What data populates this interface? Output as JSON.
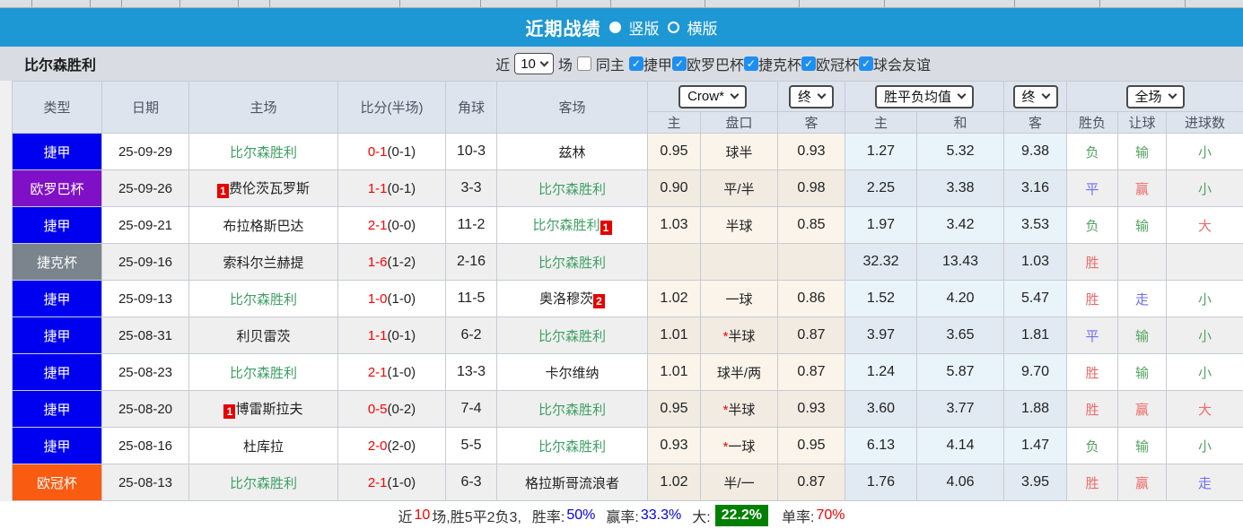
{
  "title_bar": {
    "title": "近期战绩",
    "radio_vertical": "竖版",
    "radio_horizontal": "横版"
  },
  "filter_bar": {
    "team": "比尔森胜利",
    "near_label": "近",
    "count_value": "10",
    "games_label": "场",
    "same_home_label": "同主",
    "league_filters": [
      "捷甲",
      "欧罗巴杯",
      "捷克杯",
      "欧冠杯",
      "球会友谊"
    ]
  },
  "table": {
    "columns": [
      "类型",
      "日期",
      "主场",
      "比分(半场)",
      "角球",
      "客场"
    ],
    "subcols": [
      "主",
      "盘口",
      "客",
      "主",
      "和",
      "客",
      "胜负",
      "让球",
      "进球数"
    ],
    "selects": {
      "bookmaker": "Crow*",
      "bookmaker_time": "终",
      "mean": "胜平负均值",
      "mean_time": "终",
      "scope": "全场"
    },
    "rows": [
      {
        "type": "捷甲",
        "typeColor": "#0000f0",
        "date": "25-09-29",
        "home": {
          "name": "比尔森胜利",
          "green": true
        },
        "score": "0-1",
        "half": "(0-1)",
        "corner": "10-3",
        "away": {
          "name": "兹林"
        },
        "crowHome": "0.95",
        "handicap": "球半",
        "star": false,
        "crowAway": "0.93",
        "mean": [
          "1.27",
          "5.32",
          "9.38"
        ],
        "res": [
          [
            "负",
            "green"
          ],
          [
            "输",
            "green"
          ],
          [
            "小",
            "green"
          ]
        ]
      },
      {
        "type": "欧罗巴杯",
        "typeColor": "#8010c8",
        "date": "25-09-26",
        "home": {
          "name": "费伦茨瓦罗斯",
          "redcard": "1",
          "redpos": "before"
        },
        "score": "1-1",
        "half": "(0-1)",
        "corner": "3-3",
        "away": {
          "name": "比尔森胜利",
          "green": true
        },
        "crowHome": "0.90",
        "handicap": "平/半",
        "star": false,
        "crowAway": "0.98",
        "mean": [
          "2.25",
          "3.38",
          "3.16"
        ],
        "res": [
          [
            "平",
            "blue"
          ],
          [
            "赢",
            "red"
          ],
          [
            "小",
            "green"
          ]
        ]
      },
      {
        "type": "捷甲",
        "typeColor": "#0000f0",
        "date": "25-09-21",
        "home": {
          "name": "布拉格斯巴达"
        },
        "score": "2-1",
        "half": "(0-0)",
        "corner": "11-2",
        "away": {
          "name": "比尔森胜利",
          "green": true,
          "redcard": "1",
          "redpos": "after"
        },
        "crowHome": "1.03",
        "handicap": "半球",
        "star": false,
        "crowAway": "0.85",
        "mean": [
          "1.97",
          "3.42",
          "3.53"
        ],
        "res": [
          [
            "负",
            "green"
          ],
          [
            "输",
            "green"
          ],
          [
            "大",
            "red"
          ]
        ]
      },
      {
        "type": "捷克杯",
        "typeColor": "#7b848c",
        "date": "25-09-16",
        "home": {
          "name": "索科尔兰赫提"
        },
        "score": "1-6",
        "half": "(1-2)",
        "corner": "2-16",
        "away": {
          "name": "比尔森胜利",
          "green": true
        },
        "crowHome": "",
        "handicap": "",
        "star": false,
        "crowAway": "",
        "mean": [
          "32.32",
          "13.43",
          "1.03"
        ],
        "res": [
          [
            "胜",
            "red"
          ],
          [
            "",
            ""
          ],
          [
            "",
            ""
          ]
        ]
      },
      {
        "type": "捷甲",
        "typeColor": "#0000f0",
        "date": "25-09-13",
        "home": {
          "name": "比尔森胜利",
          "green": true
        },
        "score": "1-0",
        "half": "(1-0)",
        "corner": "11-5",
        "away": {
          "name": "奥洛穆茨",
          "redcard": "2",
          "redpos": "after"
        },
        "crowHome": "1.02",
        "handicap": "一球",
        "star": false,
        "crowAway": "0.86",
        "mean": [
          "1.52",
          "4.20",
          "5.47"
        ],
        "res": [
          [
            "胜",
            "red"
          ],
          [
            "走",
            "blue"
          ],
          [
            "小",
            "green"
          ]
        ]
      },
      {
        "type": "捷甲",
        "typeColor": "#0000f0",
        "date": "25-08-31",
        "home": {
          "name": "利贝雷茨"
        },
        "score": "1-1",
        "half": "(0-1)",
        "corner": "6-2",
        "away": {
          "name": "比尔森胜利",
          "green": true
        },
        "crowHome": "1.01",
        "handicap": "半球",
        "star": true,
        "crowAway": "0.87",
        "mean": [
          "3.97",
          "3.65",
          "1.81"
        ],
        "res": [
          [
            "平",
            "blue"
          ],
          [
            "输",
            "green"
          ],
          [
            "小",
            "green"
          ]
        ]
      },
      {
        "type": "捷甲",
        "typeColor": "#0000f0",
        "date": "25-08-23",
        "home": {
          "name": "比尔森胜利",
          "green": true
        },
        "score": "2-1",
        "half": "(1-0)",
        "corner": "13-3",
        "away": {
          "name": "卡尔维纳"
        },
        "crowHome": "1.01",
        "handicap": "球半/两",
        "star": false,
        "crowAway": "0.87",
        "mean": [
          "1.24",
          "5.87",
          "9.70"
        ],
        "res": [
          [
            "胜",
            "red"
          ],
          [
            "输",
            "green"
          ],
          [
            "小",
            "green"
          ]
        ]
      },
      {
        "type": "捷甲",
        "typeColor": "#0000f0",
        "date": "25-08-20",
        "home": {
          "name": "博雷斯拉夫",
          "redcard": "1",
          "redpos": "before"
        },
        "score": "0-5",
        "half": "(0-2)",
        "corner": "7-4",
        "away": {
          "name": "比尔森胜利",
          "green": true
        },
        "crowHome": "0.95",
        "handicap": "半球",
        "star": true,
        "crowAway": "0.93",
        "mean": [
          "3.60",
          "3.77",
          "1.88"
        ],
        "res": [
          [
            "胜",
            "red"
          ],
          [
            "赢",
            "red"
          ],
          [
            "大",
            "red"
          ]
        ]
      },
      {
        "type": "捷甲",
        "typeColor": "#0000f0",
        "date": "25-08-16",
        "home": {
          "name": "杜库拉"
        },
        "score": "2-0",
        "half": "(2-0)",
        "corner": "5-5",
        "away": {
          "name": "比尔森胜利",
          "green": true
        },
        "crowHome": "0.93",
        "handicap": "一球",
        "star": true,
        "crowAway": "0.95",
        "mean": [
          "6.13",
          "4.14",
          "1.47"
        ],
        "res": [
          [
            "负",
            "green"
          ],
          [
            "输",
            "green"
          ],
          [
            "小",
            "green"
          ]
        ]
      },
      {
        "type": "欧冠杯",
        "typeColor": "#f95b10",
        "date": "25-08-13",
        "home": {
          "name": "比尔森胜利",
          "green": true
        },
        "score": "2-1",
        "half": "(1-0)",
        "corner": "6-3",
        "away": {
          "name": "格拉斯哥流浪者"
        },
        "crowHome": "1.02",
        "handicap": "半/一",
        "star": false,
        "crowAway": "0.87",
        "mean": [
          "1.76",
          "4.06",
          "3.95"
        ],
        "res": [
          [
            "胜",
            "red"
          ],
          [
            "赢",
            "red"
          ],
          [
            "走",
            "blue"
          ]
        ]
      }
    ]
  },
  "summary": {
    "prefix": "近",
    "count": "10",
    "mid": "场,胜5平2负3,",
    "win_rate_label": "胜率:",
    "win_rate": "50%",
    "odds_rate_label": "赢率:",
    "odds_rate": "33.3%",
    "big_label": "大:",
    "big_rate": "22.2%",
    "single_label": "单率:",
    "single_rate": "70%"
  },
  "colors": {
    "header_blue": "#1e98d4",
    "league_jieja": "#0000f0",
    "league_europa": "#8010c8",
    "league_czech_cup": "#7b848c",
    "league_ucl": "#f95b10",
    "team_green": "#3fa065",
    "score_red": "#fe0000",
    "result_red": "#f06a6a",
    "result_green": "#54a263",
    "result_blue": "#6e6ef5",
    "summary_chip_green": "#008000",
    "checkbox_blue": "#1e8ff0"
  }
}
